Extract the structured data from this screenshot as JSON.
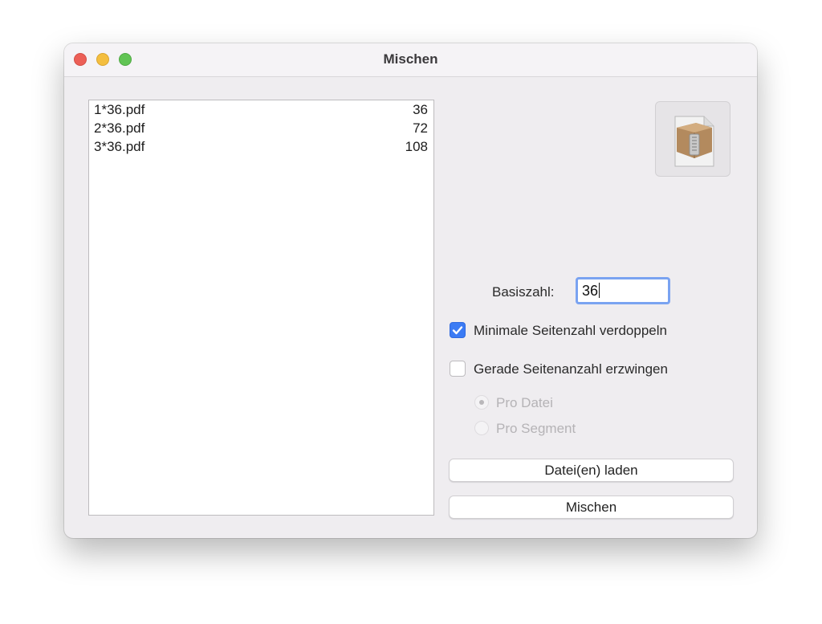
{
  "window": {
    "title": "Mischen"
  },
  "files": [
    {
      "name": "1*36.pdf",
      "count": "36"
    },
    {
      "name": "2*36.pdf",
      "count": "72"
    },
    {
      "name": "3*36.pdf",
      "count": "108"
    }
  ],
  "app_icon": "archive-utility-icon",
  "basis": {
    "label": "Basiszahl:",
    "value": "36"
  },
  "options": {
    "double_min": {
      "label": "Minimale Seitenzahl verdoppeln",
      "checked": true
    },
    "force_even": {
      "label": "Gerade Seitenanzahl erzwingen",
      "checked": false
    },
    "pro_datei": {
      "label": "Pro Datei",
      "selected": true,
      "enabled": false
    },
    "pro_segment": {
      "label": "Pro Segment",
      "selected": false,
      "enabled": false
    }
  },
  "buttons": {
    "load": "Datei(en) laden",
    "merge": "Mischen"
  },
  "colors": {
    "accent": "#3b7bf4",
    "close": "#ec5f57",
    "minimize": "#f4be3f",
    "zoom": "#61c454"
  }
}
